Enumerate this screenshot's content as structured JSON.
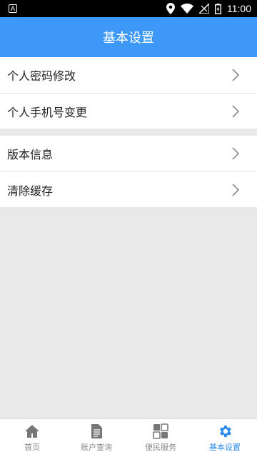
{
  "status_bar": {
    "time": "11:00",
    "notification_icon_letter": "A",
    "icons": [
      "location-icon",
      "wifi-icon",
      "signal-icon",
      "battery-icon"
    ]
  },
  "header": {
    "title": "基本设置"
  },
  "menu": {
    "group1": [
      {
        "label": "个人密码修改",
        "icon": "chevron-right-icon"
      },
      {
        "label": "个人手机号变更",
        "icon": "chevron-right-icon"
      }
    ],
    "group2": [
      {
        "label": "版本信息",
        "icon": "chevron-right-icon"
      },
      {
        "label": "清除缓存",
        "icon": "chevron-right-icon"
      }
    ]
  },
  "bottom_nav": {
    "items": [
      {
        "label": "首页",
        "icon": "home-icon",
        "active": false
      },
      {
        "label": "账户查询",
        "icon": "document-icon",
        "active": false
      },
      {
        "label": "便民服务",
        "icon": "grid-icon",
        "active": false
      },
      {
        "label": "基本设置",
        "icon": "gear-icon",
        "active": true
      }
    ]
  },
  "colors": {
    "accent": "#3d98f7",
    "active_nav": "#2a8bf2",
    "inactive_nav": "#888888",
    "background": "#e9e9e9"
  }
}
